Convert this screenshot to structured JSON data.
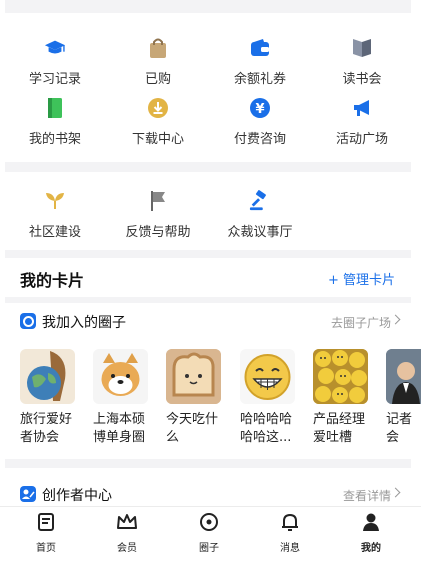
{
  "grid1": [
    {
      "label": "学习记录",
      "icon": "graduation-cap-icon"
    },
    {
      "label": "已购",
      "icon": "shopping-bag-icon"
    },
    {
      "label": "余额礼券",
      "icon": "wallet-icon"
    },
    {
      "label": "读书会",
      "icon": "open-book-icon"
    },
    {
      "label": "我的书架",
      "icon": "bookshelf-icon"
    },
    {
      "label": "下载中心",
      "icon": "download-icon"
    },
    {
      "label": "付费咨询",
      "icon": "yen-coin-icon"
    },
    {
      "label": "活动广场",
      "icon": "megaphone-icon"
    }
  ],
  "grid2": [
    {
      "label": "社区建设",
      "icon": "sprout-icon"
    },
    {
      "label": "反馈与帮助",
      "icon": "flag-icon"
    },
    {
      "label": "众裁议事厅",
      "icon": "gavel-icon"
    }
  ],
  "cards": {
    "title": "我的卡片",
    "manage": "+ 管理卡片"
  },
  "circles": {
    "title": "我加入的圈子",
    "link": "去圈子广场",
    "items": [
      {
        "name": "旅行爱好者协会",
        "image": "globe-illustration"
      },
      {
        "name": "上海本硕博单身圈",
        "image": "shiba-dog-illustration"
      },
      {
        "name": "今天吃什么",
        "image": "toast-cat-illustration"
      },
      {
        "name": "哈哈哈哈哈哈这...",
        "image": "laughing-emoji"
      },
      {
        "name": "产品经理爱吐槽",
        "image": "emoji-balls-photo"
      },
      {
        "name": "记者会",
        "image": "reporter-photo"
      }
    ]
  },
  "creator": {
    "title": "创作者中心",
    "link": "查看详情"
  },
  "tabbar": [
    {
      "label": "首页",
      "icon": "home-doc-icon"
    },
    {
      "label": "会员",
      "icon": "crown-icon"
    },
    {
      "label": "圈子",
      "icon": "circle-icon"
    },
    {
      "label": "消息",
      "icon": "bell-icon"
    },
    {
      "label": "我的",
      "icon": "person-icon"
    }
  ],
  "colors": {
    "accent": "#1a6fe8",
    "green": "#3ec25a",
    "gold": "#e2b445",
    "gray": "#555555",
    "separator": "#f3f3f5"
  }
}
